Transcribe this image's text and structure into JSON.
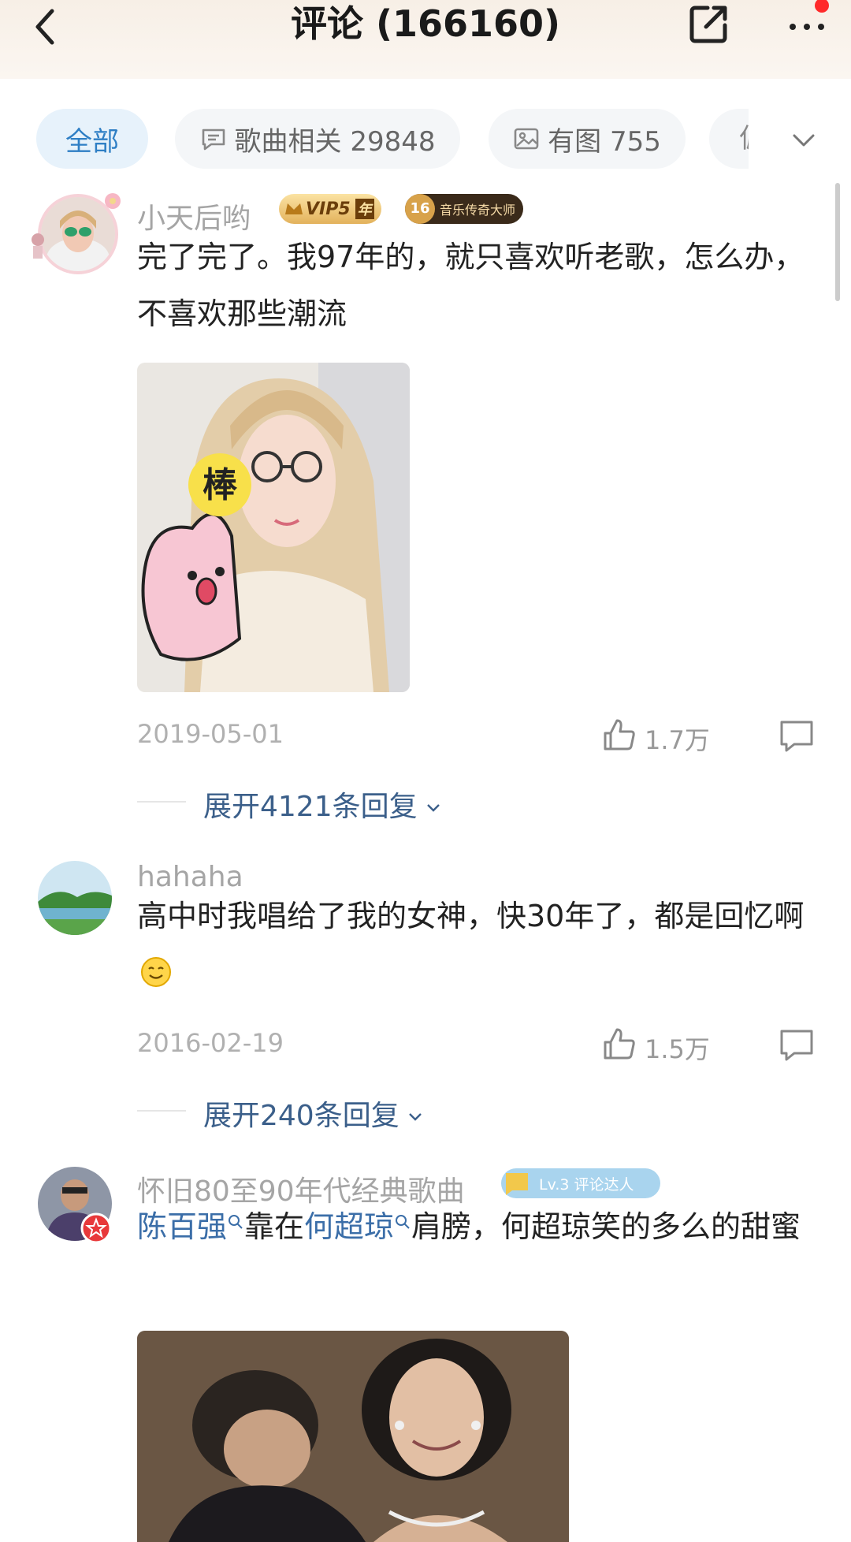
{
  "header": {
    "title": "评论 (166160)"
  },
  "tabs": [
    {
      "label": "全部"
    },
    {
      "label": "歌曲相关 29848"
    },
    {
      "label": "有图 755"
    },
    {
      "label": "偏"
    }
  ],
  "comments": [
    {
      "user": "小天后哟",
      "vip_badge": "VIP5",
      "vip_year": "年",
      "level_num": "16",
      "level_badge": "音乐传奇大师",
      "text": "完了完了。我97年的，就只喜欢听老歌，怎么办，不喜欢那些潮流",
      "sticker_text": "棒",
      "date": "2019-05-01",
      "likes": "1.7万",
      "expand": "展开4121条回复"
    },
    {
      "user": "hahaha",
      "text": "高中时我唱给了我的女神，快30年了，都是回忆啊",
      "date": "2016-02-19",
      "likes": "1.5万",
      "expand": "展开240条回复"
    },
    {
      "user": "怀旧80至90年代经典歌曲",
      "level_badge": "Lv.3 评论达人",
      "text_link1": "陈百强",
      "text_mid": "靠在",
      "text_link2": "何超琼",
      "text_rest": "肩膀，何超琼笑的多么的甜蜜"
    }
  ],
  "colors": {
    "accent": "#2f7fc5",
    "link": "#3b6ea8",
    "badge_red": "#ff2a2a"
  }
}
